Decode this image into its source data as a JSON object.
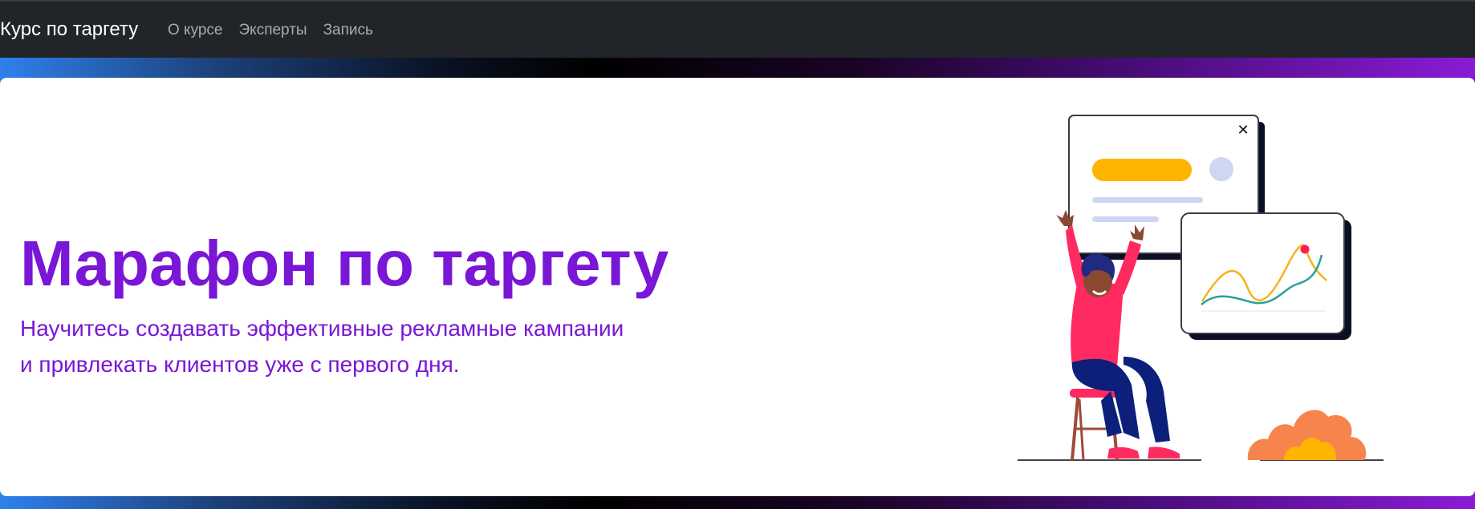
{
  "navbar": {
    "brand": "Курс по таргету",
    "links": [
      {
        "label": "О курсе"
      },
      {
        "label": "Эксперты"
      },
      {
        "label": "Запись"
      }
    ]
  },
  "hero": {
    "title": "Марафон по таргету",
    "subtitle_lines": [
      "Научитесь создавать эффективные рекламные кампании",
      "и привлекать клиентов уже с первого дня."
    ],
    "illustration_close_glyph": "✕"
  },
  "colors": {
    "navbar_bg": "#212529",
    "accent_purple": "#7a16d6",
    "illustration_yellow": "#ffb400",
    "illustration_pink": "#ff2a5f",
    "illustration_navy": "#0c1f7a"
  }
}
